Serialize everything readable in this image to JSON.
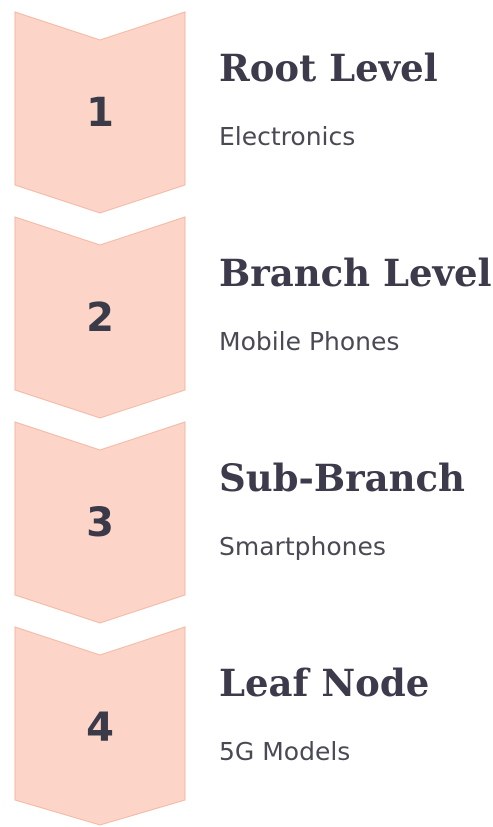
{
  "steps": [
    {
      "number": "1",
      "title": "Root Level",
      "subtitle": "Electronics"
    },
    {
      "number": "2",
      "title": "Branch Level",
      "subtitle": "Mobile Phones"
    },
    {
      "number": "3",
      "title": "Sub-Branch",
      "subtitle": "Smartphones"
    },
    {
      "number": "4",
      "title": "Leaf Node",
      "subtitle": "5G Models"
    }
  ],
  "colors": {
    "chevron_fill": "#fcd5c8",
    "chevron_stroke": "#f3b8a4",
    "number_text": "#3a3a48",
    "title_text": "#3d3a4b",
    "subtitle_text": "#4a4a55"
  }
}
